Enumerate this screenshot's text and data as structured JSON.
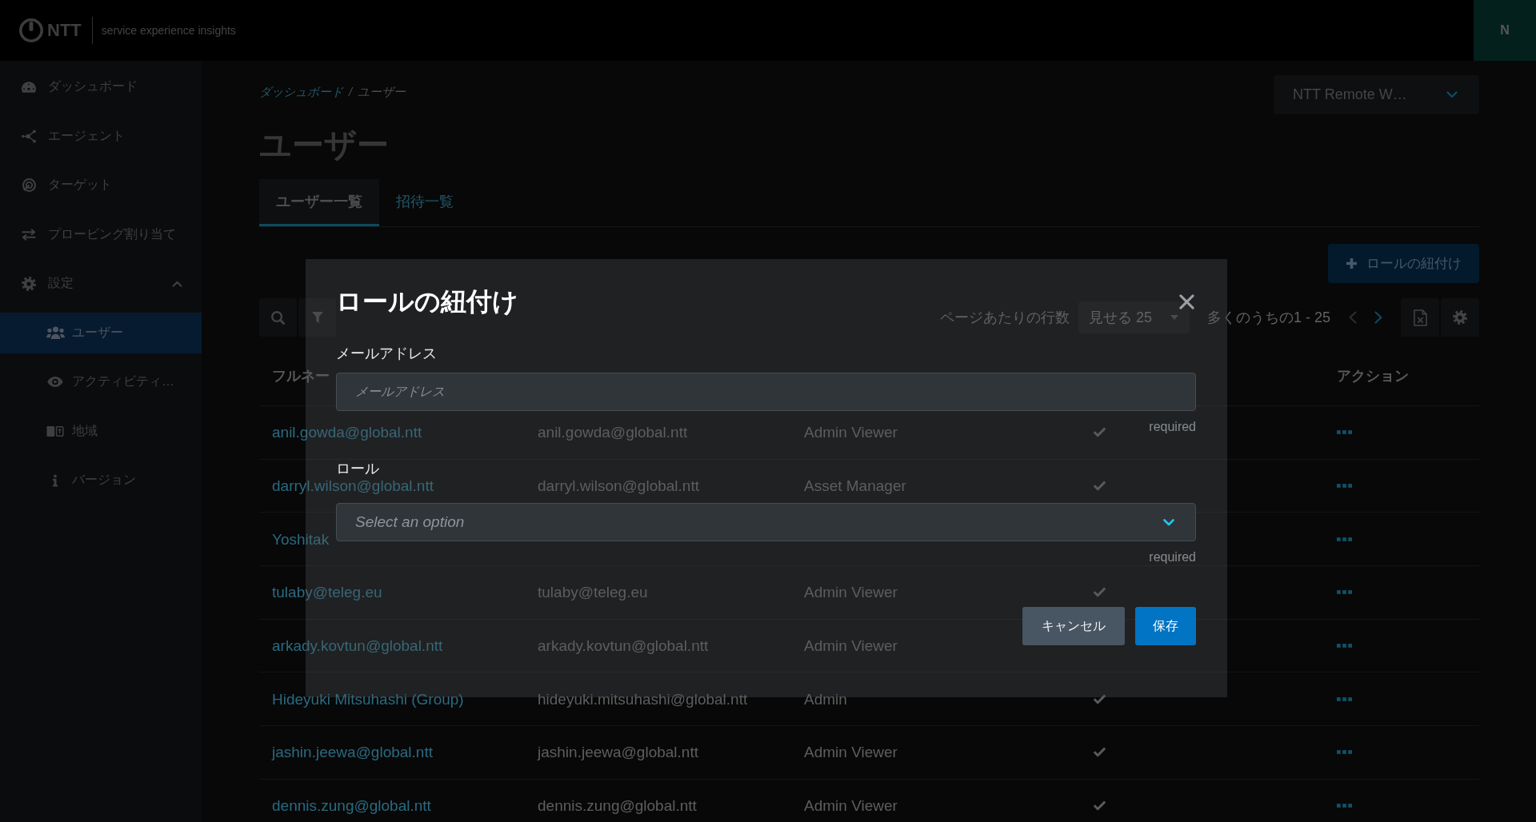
{
  "top_bar": {
    "brand": "NTT",
    "product": "service experience insights",
    "avatar_initial": "N"
  },
  "sidebar": {
    "items": [
      {
        "label": "ダッシュボード",
        "selected": false
      },
      {
        "label": "エージェント",
        "selected": false
      },
      {
        "label": "ターゲット",
        "selected": false
      },
      {
        "label": "プロービング割り当て",
        "selected": false
      },
      {
        "label": "設定",
        "selected": false,
        "expanded": true,
        "children": [
          {
            "label": "ユーザー",
            "selected": true
          },
          {
            "label": "アクティビティ…",
            "selected": false
          },
          {
            "label": "地域",
            "selected": false
          },
          {
            "label": "バージョン",
            "selected": false
          }
        ]
      }
    ]
  },
  "breadcrumb": {
    "separator": "/",
    "items": [
      {
        "label": "ダッシュボード",
        "kind": "link"
      },
      {
        "label": "ユーザー",
        "kind": "current"
      }
    ]
  },
  "account_dropdown": {
    "value": "NTT Remote W…"
  },
  "page_title": "ユーザー",
  "tabs": [
    {
      "label": "ユーザー一覧",
      "selected": true
    },
    {
      "label": "招待一覧",
      "selected": false
    }
  ],
  "add_button": {
    "label": "ロールの紐付け"
  },
  "toolbar": {
    "rows_per_page_label": "ページあたりの行数",
    "rows_per_page_value": "見せる 25",
    "range": "多くのうちの1 - 25",
    "prev_disabled": true,
    "next_disabled": false
  },
  "table": {
    "header": {
      "full_name": "フルネー",
      "actions": "アクション"
    },
    "rows": [
      {
        "full_name": "anil.gowda@global.ntt",
        "column_2": "anil.gowda@global.ntt",
        "column_3": "Admin Viewer",
        "checked": true
      },
      {
        "full_name": "darryl.wilson@global.ntt",
        "column_2": "darryl.wilson@global.ntt",
        "column_3": "Asset Manager",
        "checked": true
      },
      {
        "full_name": "Yoshitak"
      },
      {
        "full_name": "tulaby@teleg.eu",
        "column_2": "tulaby@teleg.eu",
        "column_3": "Admin Viewer",
        "checked": true
      },
      {
        "full_name": "arkady.kovtun@global.ntt",
        "column_2": "arkady.kovtun@global.ntt",
        "column_3": "Admin Viewer"
      },
      {
        "full_name": "Hideyuki Mitsuhashi (Group)",
        "column_2": "hideyuki.mitsuhashi@global.ntt",
        "column_3": "Admin",
        "checked": true
      },
      {
        "full_name": "jashin.jeewa@global.ntt",
        "column_2": "jashin.jeewa@global.ntt",
        "column_3": "Admin Viewer",
        "checked": true
      },
      {
        "full_name": "dennis.zung@global.ntt",
        "column_2": "dennis.zung@global.ntt",
        "column_3": "Admin Viewer",
        "checked": true
      }
    ]
  },
  "modal": {
    "title": "ロールの紐付け",
    "fields": [
      {
        "kind": "text",
        "label": "メールアドレス",
        "placeholder": "メールアドレス",
        "hint": "required"
      },
      {
        "kind": "select",
        "label": "ロール",
        "placeholder": "Select an option",
        "hint": "required"
      }
    ],
    "buttons": [
      {
        "kind": "secondary",
        "label": "キャンセル"
      },
      {
        "kind": "primary",
        "label": "保存"
      }
    ]
  }
}
